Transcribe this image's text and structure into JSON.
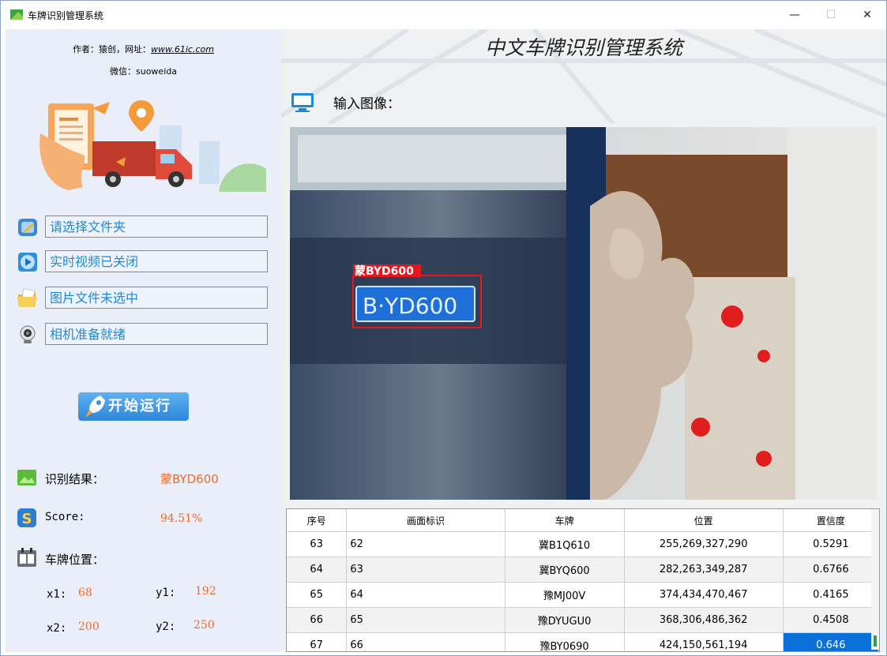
{
  "window": {
    "title": "车牌识别管理系统",
    "buttons": {
      "minimize": "—",
      "maximize": "☐",
      "close": "✕"
    }
  },
  "sidebar": {
    "author_prefix": "作者：猿创，网址：",
    "author_url": "www.61ic.com",
    "wechat": "微信：suoweida",
    "items": [
      {
        "label": "请选择文件夹",
        "icon": "folder-select-icon"
      },
      {
        "label": "实时视频已关闭",
        "icon": "video-play-icon"
      },
      {
        "label": "图片文件未选中",
        "icon": "image-folder-icon"
      },
      {
        "label": "相机准备就绪",
        "icon": "webcam-icon"
      }
    ],
    "run_button": "开始运行"
  },
  "results": {
    "result_label": "识别结果：",
    "result_value": "蒙BYD600",
    "score_label": "Score:",
    "score_value": "94.51%",
    "position_label": "车牌位置：",
    "x1_label": "x1:",
    "x1": "68",
    "y1_label": "y1:",
    "y1": "192",
    "x2_label": "x2:",
    "x2": "200",
    "y2_label": "y2:",
    "y2": "250"
  },
  "main": {
    "title": "中文车牌识别管理系统",
    "input_label": "输入图像：",
    "detection_label": "蒙BYD600",
    "plate_text": "B·YD600"
  },
  "table": {
    "headers": [
      "序号",
      "画面标识",
      "车牌",
      "位置",
      "置信度"
    ],
    "rows": [
      [
        "63",
        "62",
        "冀B1Q610",
        "255,269,327,290",
        "0.5291"
      ],
      [
        "64",
        "63",
        "冀BYQ600",
        "282,263,349,287",
        "0.6766"
      ],
      [
        "65",
        "64",
        "豫MJ00V",
        "374,434,470,467",
        "0.4165"
      ],
      [
        "66",
        "65",
        "豫DYUGU0",
        "368,306,486,362",
        "0.4508"
      ],
      [
        "67",
        "66",
        "豫BY0690",
        "424,150,561,194",
        "0.646"
      ]
    ]
  },
  "colors": {
    "accent": "#1e8ad6",
    "value": "#f06a2a",
    "selection": "#0a6fd6",
    "detection_box": "#e8141e"
  }
}
